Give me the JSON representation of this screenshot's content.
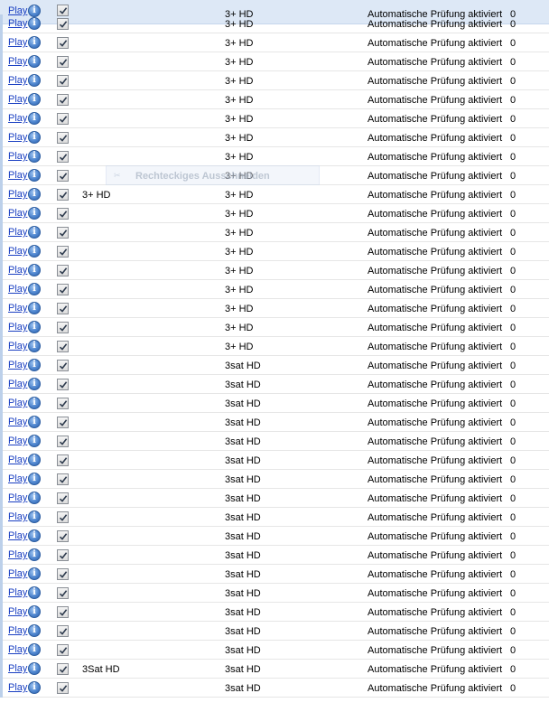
{
  "grid": {
    "play_label": "Play",
    "info_glyph": "i",
    "rows": [
      {
        "group": "",
        "channel": "3+ HD",
        "status": "Automatische Prüfung aktiviert",
        "count": "0",
        "checked": true
      },
      {
        "group": "",
        "channel": "3+ HD",
        "status": "Automatische Prüfung aktiviert",
        "count": "0",
        "checked": true
      },
      {
        "group": "",
        "channel": "3+ HD",
        "status": "Automatische Prüfung aktiviert",
        "count": "0",
        "checked": true
      },
      {
        "group": "",
        "channel": "3+ HD",
        "status": "Automatische Prüfung aktiviert",
        "count": "0",
        "checked": true
      },
      {
        "group": "",
        "channel": "3+ HD",
        "status": "Automatische Prüfung aktiviert",
        "count": "0",
        "checked": true
      },
      {
        "group": "",
        "channel": "3+ HD",
        "status": "Automatische Prüfung aktiviert",
        "count": "0",
        "checked": true
      },
      {
        "group": "",
        "channel": "3+ HD",
        "status": "Automatische Prüfung aktiviert",
        "count": "0",
        "checked": true
      },
      {
        "group": "",
        "channel": "3+ HD",
        "status": "Automatische Prüfung aktiviert",
        "count": "0",
        "checked": true
      },
      {
        "group": "",
        "channel": "3+ HD",
        "status": "Automatische Prüfung aktiviert",
        "count": "0",
        "checked": true
      },
      {
        "group": "",
        "channel": "3+ HD",
        "status": "Automatische Prüfung aktiviert",
        "count": "0",
        "checked": true
      },
      {
        "group": "3+ HD",
        "channel": "3+ HD",
        "status": "Automatische Prüfung aktiviert",
        "count": "0",
        "checked": true
      },
      {
        "group": "",
        "channel": "3+ HD",
        "status": "Automatische Prüfung aktiviert",
        "count": "0",
        "checked": true
      },
      {
        "group": "",
        "channel": "3+ HD",
        "status": "Automatische Prüfung aktiviert",
        "count": "0",
        "checked": true
      },
      {
        "group": "",
        "channel": "3+ HD",
        "status": "Automatische Prüfung aktiviert",
        "count": "0",
        "checked": true
      },
      {
        "group": "",
        "channel": "3+ HD",
        "status": "Automatische Prüfung aktiviert",
        "count": "0",
        "checked": true
      },
      {
        "group": "",
        "channel": "3+ HD",
        "status": "Automatische Prüfung aktiviert",
        "count": "0",
        "checked": true
      },
      {
        "group": "",
        "channel": "3+ HD",
        "status": "Automatische Prüfung aktiviert",
        "count": "0",
        "checked": true
      },
      {
        "group": "",
        "channel": "3+ HD",
        "status": "Automatische Prüfung aktiviert",
        "count": "0",
        "checked": true
      },
      {
        "group": "",
        "channel": "3+ HD",
        "status": "Automatische Prüfung aktiviert",
        "count": "0",
        "checked": true
      },
      {
        "group": "",
        "channel": "3sat HD",
        "status": "Automatische Prüfung aktiviert",
        "count": "0",
        "checked": true
      },
      {
        "group": "",
        "channel": "3sat HD",
        "status": "Automatische Prüfung aktiviert",
        "count": "0",
        "checked": true
      },
      {
        "group": "",
        "channel": "3sat HD",
        "status": "Automatische Prüfung aktiviert",
        "count": "0",
        "checked": true
      },
      {
        "group": "",
        "channel": "3sat HD",
        "status": "Automatische Prüfung aktiviert",
        "count": "0",
        "checked": true
      },
      {
        "group": "",
        "channel": "3sat HD",
        "status": "Automatische Prüfung aktiviert",
        "count": "0",
        "checked": true
      },
      {
        "group": "",
        "channel": "3sat HD",
        "status": "Automatische Prüfung aktiviert",
        "count": "0",
        "checked": true
      },
      {
        "group": "",
        "channel": "3sat HD",
        "status": "Automatische Prüfung aktiviert",
        "count": "0",
        "checked": true
      },
      {
        "group": "",
        "channel": "3sat HD",
        "status": "Automatische Prüfung aktiviert",
        "count": "0",
        "checked": true
      },
      {
        "group": "",
        "channel": "3sat HD",
        "status": "Automatische Prüfung aktiviert",
        "count": "0",
        "checked": true
      },
      {
        "group": "",
        "channel": "3sat HD",
        "status": "Automatische Prüfung aktiviert",
        "count": "0",
        "checked": true
      },
      {
        "group": "",
        "channel": "3sat HD",
        "status": "Automatische Prüfung aktiviert",
        "count": "0",
        "checked": true
      },
      {
        "group": "",
        "channel": "3sat HD",
        "status": "Automatische Prüfung aktiviert",
        "count": "0",
        "checked": true
      },
      {
        "group": "",
        "channel": "3sat HD",
        "status": "Automatische Prüfung aktiviert",
        "count": "0",
        "checked": true
      },
      {
        "group": "",
        "channel": "3sat HD",
        "status": "Automatische Prüfung aktiviert",
        "count": "0",
        "checked": true
      },
      {
        "group": "",
        "channel": "3sat HD",
        "status": "Automatische Prüfung aktiviert",
        "count": "0",
        "checked": true
      },
      {
        "group": "",
        "channel": "3sat HD",
        "status": "Automatische Prüfung aktiviert",
        "count": "0",
        "checked": true
      },
      {
        "group": "3Sat HD",
        "channel": "3sat HD",
        "status": "Automatische Prüfung aktiviert",
        "count": "0",
        "checked": true
      },
      {
        "group": "",
        "channel": "3sat HD",
        "status": "Automatische Prüfung aktiviert",
        "count": "0",
        "checked": true
      }
    ]
  },
  "drag_ghost": {
    "label": "Rechteckiges Ausschneiden",
    "icon": "scissors-icon"
  },
  "colors": {
    "link": "#1a3fc2",
    "selected_row": "#dde8f6",
    "info_icon": "#4f86cf"
  }
}
